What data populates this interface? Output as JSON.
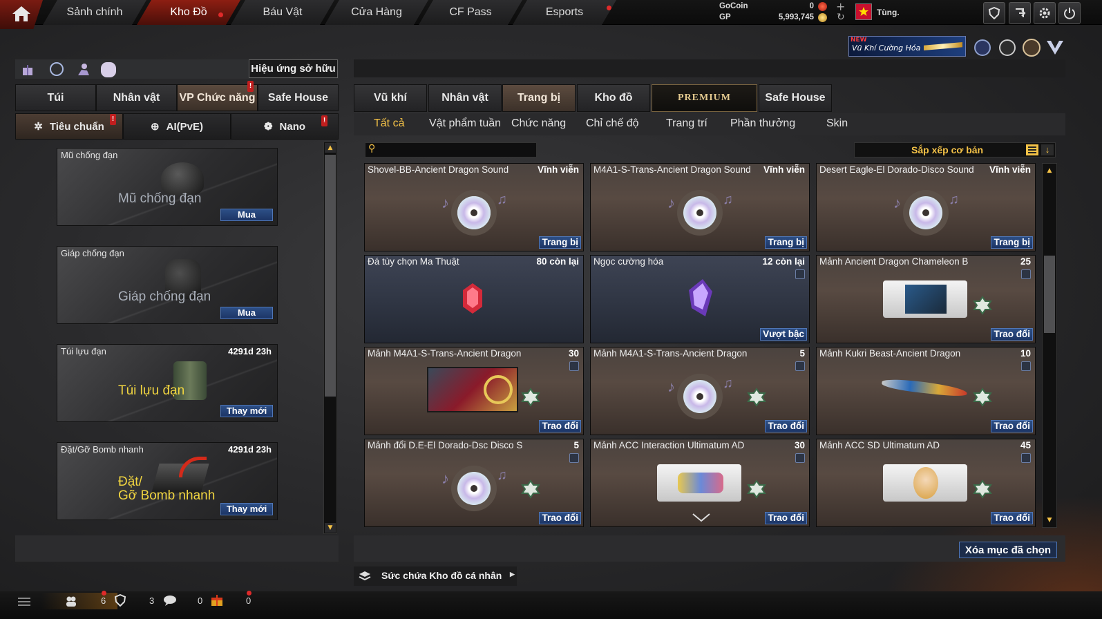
{
  "topnav": {
    "tabs": [
      {
        "label": "Sảnh chính"
      },
      {
        "label": "Kho Đồ"
      },
      {
        "label": "Báu Vật"
      },
      {
        "label": "Cửa Hàng"
      },
      {
        "label": "CF Pass"
      },
      {
        "label": "Esports"
      }
    ],
    "gocoin_label": "GoCoin",
    "gocoin_value": "0",
    "gp_label": "GP",
    "gp_value": "5,993,745",
    "username": "Tùng.",
    "promo_new": "NEW",
    "promo_text": "Vũ Khí Cường Hóa"
  },
  "left": {
    "effects_button": "Hiệu ứng sở hữu",
    "tabs": [
      "Túi",
      "Nhân vật",
      "VP Chức năng",
      "Safe House"
    ],
    "subtabs": [
      "Tiêu chuẩn",
      "AI(PvE)",
      "Nano"
    ],
    "items": [
      {
        "name": "Mũ chống đạn",
        "big": "Mũ chống đạn",
        "time": "",
        "button": "Mua"
      },
      {
        "name": "Giáp chống đạn",
        "big": "Giáp chống đạn",
        "time": "",
        "button": "Mua"
      },
      {
        "name": "Túi lựu đạn",
        "big": "Túi lựu đạn",
        "time": "4291d 23h",
        "button": "Thay mới"
      },
      {
        "name": "Đặt/Gỡ Bomb nhanh",
        "big": "Đặt/",
        "big2": "Gỡ Bomb nhanh",
        "time": "4291d 23h",
        "button": "Thay mới"
      }
    ]
  },
  "right": {
    "tabs": [
      "Vũ khí",
      "Nhân vật",
      "Trang bị",
      "Kho đồ",
      "PREMIUM",
      "Safe House"
    ],
    "subtabs": [
      "Tất cả",
      "Vật phẩm tuần",
      "Chức năng",
      "Chỉ chế độ",
      "Trang trí",
      "Phần thưởng",
      "Skin"
    ],
    "search_placeholder": "",
    "sort_label": "Sắp xếp cơ bản",
    "items": [
      {
        "name": "Shovel-BB-Ancient Dragon Sound",
        "status": "Vĩnh viễn",
        "button": "Trang bị"
      },
      {
        "name": "M4A1-S-Trans-Ancient Dragon Sound",
        "status": "Vĩnh viễn",
        "button": "Trang bị"
      },
      {
        "name": "Desert Eagle-El Dorado-Disco Sound",
        "status": "Vĩnh viễn",
        "button": "Trang bị"
      },
      {
        "name": "Đá tùy chọn Ma Thuật",
        "status": "80 còn lại",
        "button": ""
      },
      {
        "name": "Ngọc cường hóa",
        "status": "12 còn lại",
        "button": "Vượt bậc"
      },
      {
        "name": "Mảnh Ancient Dragon Chameleon B",
        "status": "25",
        "button": "Trao đổi"
      },
      {
        "name": "Mảnh M4A1-S-Trans-Ancient Dragon",
        "status": "30",
        "button": "Trao đổi"
      },
      {
        "name": "Mảnh M4A1-S-Trans-Ancient Dragon",
        "status": "5",
        "button": "Trao đổi"
      },
      {
        "name": "Mảnh Kukri Beast-Ancient Dragon",
        "status": "10",
        "button": "Trao đổi"
      },
      {
        "name": "Mảnh đổi D.E-El Dorado-Dsc Disco S",
        "status": "5",
        "button": "Trao đổi"
      },
      {
        "name": "Mảnh ACC Interaction Ultimatum AD",
        "status": "30",
        "button": "Trao đổi"
      },
      {
        "name": "Mảnh ACC SD Ultimatum AD",
        "status": "45",
        "button": "Trao đổi"
      }
    ],
    "delete_selected": "Xóa mục đã chọn",
    "capacity": "Sức chứa Kho đồ cá nhân"
  },
  "bottom": {
    "count1": "6",
    "count2": "3",
    "count3": "0",
    "count4": "0"
  },
  "colors": {
    "accent_red": "#8d1e12",
    "button_blue": "#2d4f86",
    "gold": "#f4c247"
  }
}
